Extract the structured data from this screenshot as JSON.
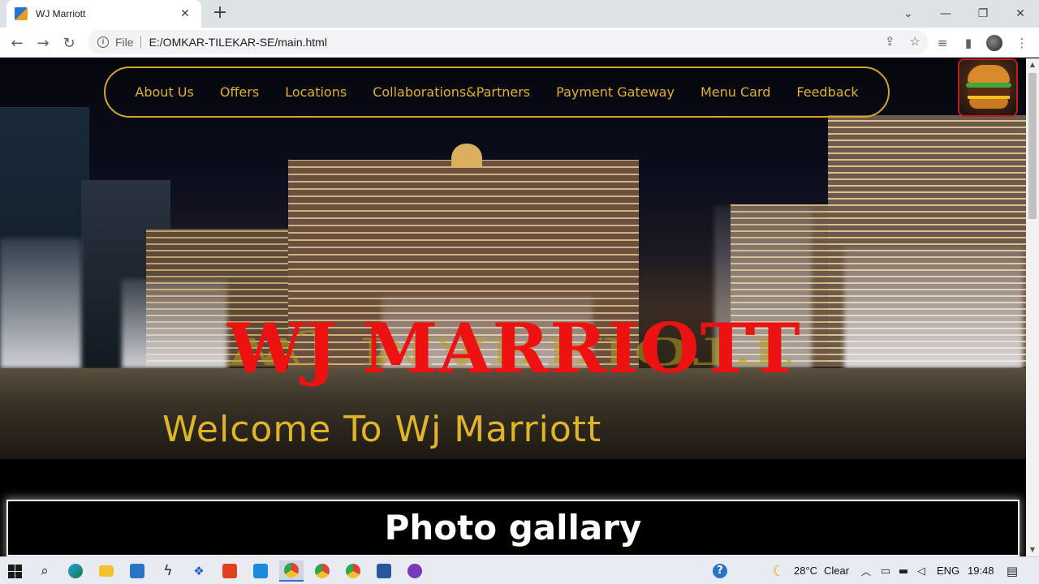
{
  "browser": {
    "tab_title": "WJ Marriott",
    "omnibox_scheme": "File",
    "omnibox_url": "E:/OMKAR-TILEKAR-SE/main.html"
  },
  "page": {
    "nav": [
      "About Us",
      "Offers",
      "Locations",
      "Collaborations&Partners",
      "Payment Gateway",
      "Menu Card",
      "Feedback"
    ],
    "hero_title": "WJ MARRIOTT",
    "hero_subtitle": "Welcome To Wj Marriott",
    "gallery_title": "Photo gallary",
    "colors": {
      "nav_border": "#d4a52a",
      "nav_text": "#e0b030",
      "title": "#ee1111",
      "subtitle": "#e0b428"
    }
  },
  "taskbar": {
    "weather_temp": "28°C",
    "weather_desc": "Clear",
    "language": "ENG",
    "time": "19:48"
  }
}
